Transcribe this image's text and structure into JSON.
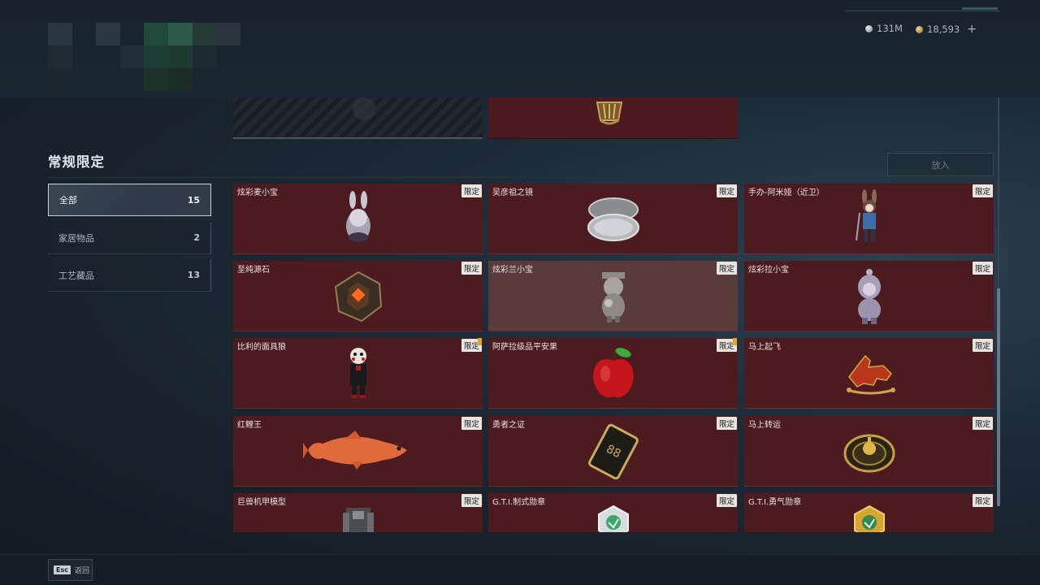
{
  "currency": {
    "silver_value": "131M",
    "gold_value": "18,593",
    "plus_icon": "+"
  },
  "section_title": "常规限定",
  "put_button_label": "放入",
  "categories": [
    {
      "label": "全部",
      "count": "15",
      "active": true
    },
    {
      "label": "家居物品",
      "count": "2",
      "active": false
    },
    {
      "label": "工艺藏品",
      "count": "13",
      "active": false
    }
  ],
  "items": [
    {
      "name": "炫彩麦小宝",
      "tag": "限定",
      "icon": "bunny-figurine-icon",
      "flag": false
    },
    {
      "name": "吴彦祖之镜",
      "tag": "限定",
      "icon": "pocket-mirror-icon",
      "flag": false
    },
    {
      "name": "手办-阿米娅（近卫）",
      "tag": "限定",
      "icon": "amiya-figurine-icon",
      "flag": false
    },
    {
      "name": "至纯源石",
      "tag": "限定",
      "icon": "originium-stone-icon",
      "flag": false
    },
    {
      "name": "炫彩兰小宝",
      "tag": "限定",
      "icon": "lan-figurine-icon",
      "flag": false,
      "selected": true
    },
    {
      "name": "炫彩拉小宝",
      "tag": "限定",
      "icon": "hooded-figurine-icon",
      "flag": false
    },
    {
      "name": "比利的面具狼",
      "tag": "限定",
      "icon": "billy-puppet-icon",
      "flag": true
    },
    {
      "name": "阿萨拉级品平安果",
      "tag": "限定",
      "icon": "apple-icon",
      "flag": true
    },
    {
      "name": "马上起飞",
      "tag": "限定",
      "icon": "red-horse-icon",
      "flag": false
    },
    {
      "name": "红鲤王",
      "tag": "限定",
      "icon": "koi-fish-icon",
      "flag": false
    },
    {
      "name": "勇者之证",
      "tag": "限定",
      "icon": "brave-card-icon",
      "flag": false
    },
    {
      "name": "马上转运",
      "tag": "限定",
      "icon": "golden-compass-icon",
      "flag": false
    },
    {
      "name": "巨兽机甲模型",
      "tag": "限定",
      "icon": "mech-model-icon",
      "flag": false
    },
    {
      "name": "G.T.I.制式勋章",
      "tag": "限定",
      "icon": "silver-medal-icon",
      "flag": false
    },
    {
      "name": "G.T.I.勇气勋章",
      "tag": "限定",
      "icon": "gold-medal-icon",
      "flag": false
    }
  ],
  "footer": {
    "esc_key": "Esc",
    "back_label": "返回"
  }
}
